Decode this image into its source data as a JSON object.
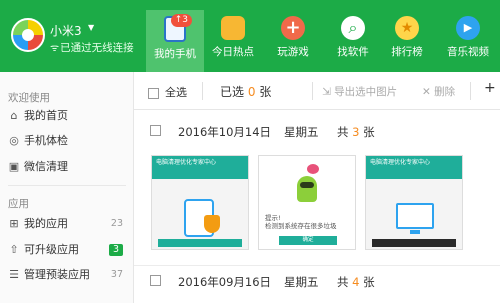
{
  "device": {
    "name": "小米3",
    "caret": "▼",
    "wifi_icon": "ᯤ",
    "status": "已通过无线连接"
  },
  "nav": {
    "items": [
      {
        "label": "我的手机",
        "icon": "phone-icon",
        "badge": "↑3",
        "active": true
      },
      {
        "label": "今日热点",
        "icon": "hot-icon"
      },
      {
        "label": "玩游戏",
        "icon": "gamepad-icon"
      },
      {
        "label": "找软件",
        "icon": "find-app-icon"
      },
      {
        "label": "排行榜",
        "icon": "ranking-icon"
      },
      {
        "label": "音乐视频",
        "icon": "video-icon"
      }
    ]
  },
  "sidebar": {
    "section1": "欢迎使用",
    "section2": "应用",
    "items": [
      {
        "label": "我的首页",
        "icon": "⌂"
      },
      {
        "label": "手机体检",
        "icon": "◎"
      },
      {
        "label": "微信清理",
        "icon": "▣"
      },
      {
        "label": "我的应用",
        "icon": "⊞",
        "count": "23"
      },
      {
        "label": "可升级应用",
        "icon": "⇧",
        "count": "3"
      },
      {
        "label": "管理预装应用",
        "icon": "☰",
        "count": "37"
      }
    ]
  },
  "toolbar": {
    "select_all": "全选",
    "selected_prefix": "已选",
    "selected_count": "0",
    "selected_suffix": "张",
    "export_icon": "⇲",
    "export_label": "导出选中图片",
    "delete_icon": "✕",
    "delete_label": "删除",
    "more": "+"
  },
  "groups": [
    {
      "date": "2016年10月14日",
      "weekday": "星期五",
      "count_prefix": "共",
      "count": "3",
      "count_suffix": "张"
    },
    {
      "date": "2016年09月16日",
      "weekday": "星期五",
      "count_prefix": "共",
      "count": "4",
      "count_suffix": "张"
    }
  ],
  "thumbs": {
    "t1_header": "电脑清理优化专家中心",
    "t2_text_line1": "提示!",
    "t2_text_line2": "检测到系统存在很多垃圾",
    "t2_button": "确定",
    "t3_header": "电脑清理优化专家中心"
  },
  "colors": {
    "brand_green": "#1cab47",
    "accent_orange": "#f58b1f",
    "badge_red": "#f0503c"
  }
}
